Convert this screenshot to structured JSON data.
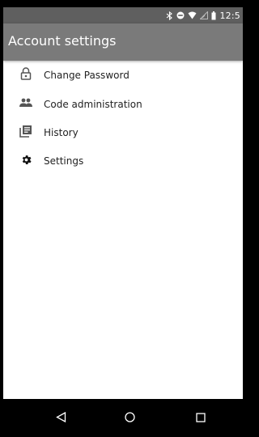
{
  "status_bar": {
    "time": "12:5",
    "icons": [
      "bluetooth-icon",
      "do-not-disturb-icon",
      "wifi-icon",
      "signal-icon",
      "battery-icon"
    ]
  },
  "app_bar": {
    "title": "Account settings"
  },
  "menu": {
    "items": [
      {
        "label": "Change Password",
        "icon": "lock-icon"
      },
      {
        "label": "Code administration",
        "icon": "people-icon"
      },
      {
        "label": "History",
        "icon": "library-books-icon"
      },
      {
        "label": "Settings",
        "icon": "gear-icon"
      }
    ]
  },
  "navigation": {
    "buttons": [
      "back-icon",
      "home-icon",
      "recents-icon"
    ]
  },
  "colors": {
    "status_bar": "#5f5f5f",
    "app_bar": "#7a7a7a",
    "background": "#ffffff",
    "nav_bar": "#000000"
  }
}
